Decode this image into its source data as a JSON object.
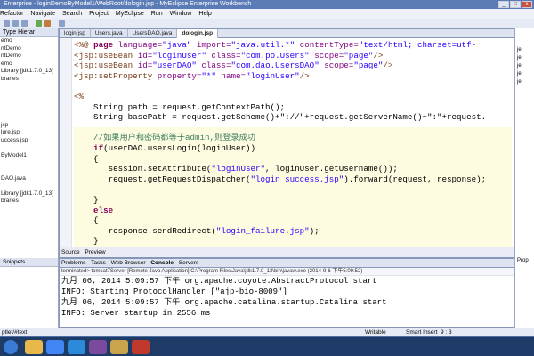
{
  "window": {
    "title": "Enterprise - loginDemoByModel1/WebRoot/dologin.jsp - MyEclipse Enterprise Workbench",
    "btn_min": "_",
    "btn_max": "□",
    "btn_close": "x"
  },
  "menu": [
    "Refactor",
    "Navigate",
    "Search",
    "Project",
    "MyEclipse",
    "Run",
    "Window",
    "Help"
  ],
  "left_panel": {
    "tab": "Type Hierar",
    "tree": [
      "emo",
      "ntDemo",
      "ntDemo",
      "emo",
      "",
      "Library [jdk1.7.0_13]",
      "braries",
      "",
      "",
      "",
      "",
      "",
      "jsp",
      "lure.jsp",
      "uccess.jsp",
      "",
      "ByModel1",
      "",
      "",
      "DAO.java",
      "",
      "Library [jdk1.7.0_13]",
      "braries"
    ]
  },
  "editor": {
    "tabs": [
      "login.jsp",
      "Users.java",
      "UsersDAO.java",
      "dologin.jsp"
    ],
    "active_tab": 3,
    "lines": [
      {
        "segs": [
          [
            "tagc",
            "<%@ "
          ],
          [
            "kw",
            "page "
          ],
          [
            "attr",
            "language="
          ],
          [
            "str",
            "\"java\" "
          ],
          [
            "attr",
            "import="
          ],
          [
            "str",
            "\"java.util.*\" "
          ],
          [
            "attr",
            "contentType="
          ],
          [
            "str",
            "\"text/html; charset=utf-"
          ]
        ]
      },
      {
        "segs": [
          [
            "tagc",
            "<jsp:useBean "
          ],
          [
            "attr",
            "id="
          ],
          [
            "str",
            "\"loginUser\" "
          ],
          [
            "attr",
            "class="
          ],
          [
            "str",
            "\"com.po.Users\" "
          ],
          [
            "attr",
            "scope="
          ],
          [
            "str",
            "\"page\""
          ],
          [
            "tagc",
            "/>"
          ]
        ]
      },
      {
        "segs": [
          [
            "tagc",
            "<jsp:useBean "
          ],
          [
            "attr",
            "id="
          ],
          [
            "str",
            "\"userDAO\" "
          ],
          [
            "attr",
            "class="
          ],
          [
            "str",
            "\"com.dao.UsersDAO\" "
          ],
          [
            "attr",
            "scope="
          ],
          [
            "str",
            "\"page\""
          ],
          [
            "tagc",
            "/>"
          ]
        ]
      },
      {
        "segs": [
          [
            "tagc",
            "<jsp:setProperty "
          ],
          [
            "attr",
            "property="
          ],
          [
            "str",
            "\"*\" "
          ],
          [
            "attr",
            "name="
          ],
          [
            "str",
            "\"loginUser\""
          ],
          [
            "tagc",
            "/>"
          ]
        ]
      },
      {
        "segs": [
          [
            "",
            ""
          ]
        ]
      },
      {
        "segs": [
          [
            "tagc",
            "<%"
          ]
        ]
      },
      {
        "segs": [
          [
            "",
            "    String path = request.getContextPath();"
          ]
        ]
      },
      {
        "segs": [
          [
            "",
            "    String basePath = request.getScheme()+\"://\"+request.getServerName()+\":\"+request."
          ]
        ]
      },
      {
        "segs": [
          [
            "",
            ""
          ]
        ]
      },
      {
        "segs": [
          [
            "cmt",
            "    //如果用户和密码都等于admin,则登录成功"
          ]
        ]
      },
      {
        "segs": [
          [
            "kw",
            "    if"
          ],
          [
            "",
            "(userDAO.usersLogin(loginUser))"
          ]
        ]
      },
      {
        "segs": [
          [
            "",
            "    {"
          ]
        ]
      },
      {
        "segs": [
          [
            "",
            "       session.setAttribute("
          ],
          [
            "str",
            "\"loginUser\""
          ],
          [
            "",
            ", loginUser.getUsername());"
          ]
        ]
      },
      {
        "segs": [
          [
            "",
            "       request.getRequestDispatcher("
          ],
          [
            "str",
            "\"login_success.jsp\""
          ],
          [
            "",
            ").forward(request, response);"
          ]
        ]
      },
      {
        "segs": [
          [
            "",
            ""
          ]
        ]
      },
      {
        "segs": [
          [
            "",
            "    }"
          ]
        ]
      },
      {
        "segs": [
          [
            "kw",
            "    else"
          ]
        ]
      },
      {
        "segs": [
          [
            "",
            "    {"
          ]
        ]
      },
      {
        "segs": [
          [
            "",
            "       response.sendRedirect("
          ],
          [
            "str",
            "\"login_failure.jsp\""
          ],
          [
            "",
            ");"
          ]
        ]
      },
      {
        "segs": [
          [
            "",
            "    }"
          ]
        ]
      }
    ],
    "bottom_tabs": [
      "Source",
      "Preview"
    ]
  },
  "right_panel": {
    "items": [
      "je",
      "je",
      "je",
      "je",
      "je"
    ]
  },
  "console_area": {
    "tabs": [
      "Problems",
      "Tasks",
      "Web Browser",
      "Console",
      "Servers"
    ],
    "status": "terminated> tomcat7Server [Remote Java Application] C:\\Program Files\\Java\\jdk1.7.0_13\\bin\\javaw.exe (2014-9-6 下午5:09:52)",
    "lines": [
      "九月 06, 2014 5:09:57 下午 org.apache.coyote.AbstractProtocol start",
      "INFO: Starting ProtocolHandler [\"ajp-bio-8009\"]",
      "九月 06, 2014 5:09:57 下午 org.apache.catalina.startup.Catalina start",
      "INFO: Server startup in 2556 ms"
    ]
  },
  "bottom_left": {
    "tab": "Snippets",
    "items": [
      "",
      "",
      "",
      ""
    ]
  },
  "right_bottom": {
    "label": "Prop"
  },
  "status_bar": {
    "left": "ptlet/#text",
    "writable": "Writable",
    "insert": "Smart Insert",
    "pos": "9 : 3"
  },
  "taskbar": {
    "icons": [
      "windows-start",
      "explorer",
      "chrome",
      "ie",
      "myeclipse",
      "folder",
      "media"
    ]
  }
}
